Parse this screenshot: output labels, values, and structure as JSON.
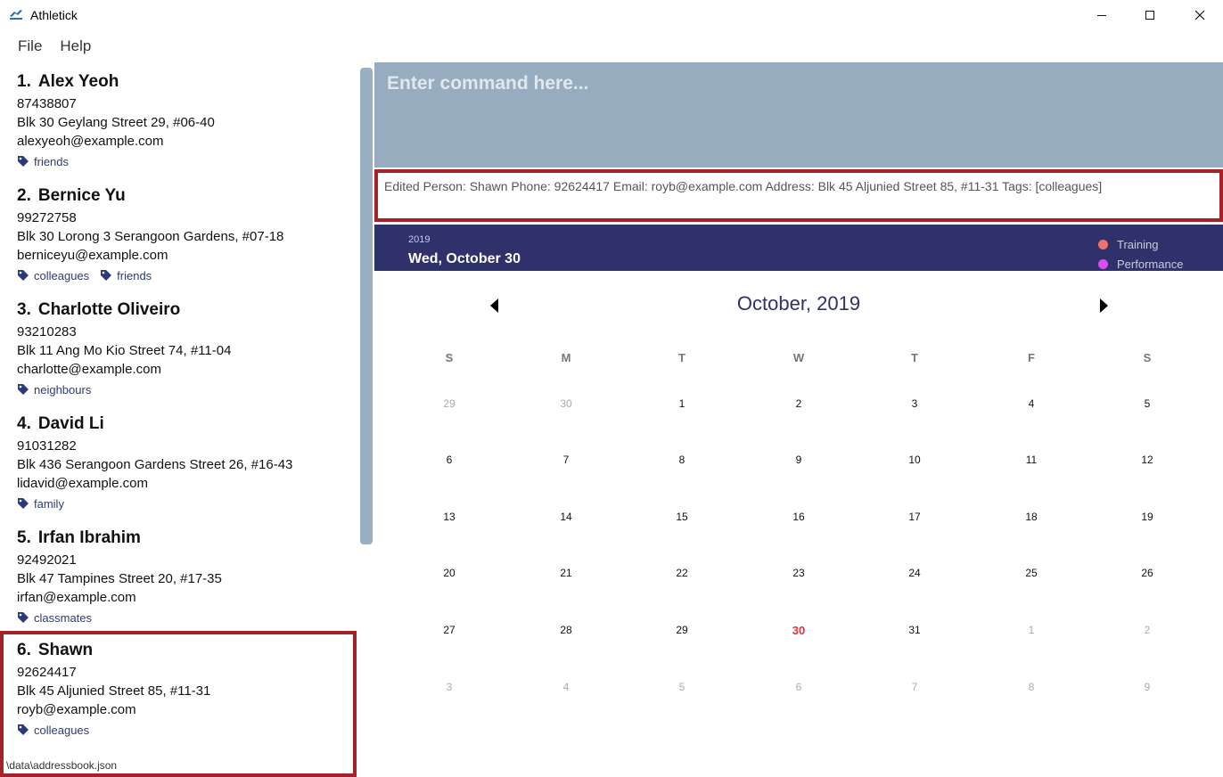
{
  "window": {
    "title": "Athletick",
    "minimize_label": "—",
    "maximize_label": "☐",
    "close_label": "✕"
  },
  "menu": {
    "items": [
      {
        "label": "File"
      },
      {
        "label": "Help"
      }
    ]
  },
  "persons": [
    {
      "index": "1.",
      "name": "Alex Yeoh",
      "phone": "87438807",
      "address": "Blk 30 Geylang Street 29, #06-40",
      "email": "alexyeoh@example.com",
      "tags": [
        "friends"
      ]
    },
    {
      "index": "2.",
      "name": "Bernice Yu",
      "phone": "99272758",
      "address": "Blk 30 Lorong 3 Serangoon Gardens, #07-18",
      "email": "berniceyu@example.com",
      "tags": [
        "colleagues",
        "friends"
      ]
    },
    {
      "index": "3.",
      "name": "Charlotte Oliveiro",
      "phone": "93210283",
      "address": "Blk 11 Ang Mo Kio Street 74, #11-04",
      "email": "charlotte@example.com",
      "tags": [
        "neighbours"
      ]
    },
    {
      "index": "4.",
      "name": "David Li",
      "phone": "91031282",
      "address": "Blk 436 Serangoon Gardens Street 26, #16-43",
      "email": "lidavid@example.com",
      "tags": [
        "family"
      ]
    },
    {
      "index": "5.",
      "name": "Irfan Ibrahim",
      "phone": "92492021",
      "address": "Blk 47 Tampines Street 20, #17-35",
      "email": "irfan@example.com",
      "tags": [
        "classmates"
      ]
    },
    {
      "index": "6.",
      "name": "Shawn",
      "phone": "92624417",
      "address": "Blk 45 Aljunied Street 85, #11-31",
      "email": "royb@example.com",
      "tags": [
        "colleagues"
      ]
    }
  ],
  "status_bar": {
    "storage_path": "\\data\\addressbook.json"
  },
  "command": {
    "placeholder": "Enter command here..."
  },
  "result": {
    "text": "Edited Person: Shawn Phone: 92624417 Email: royb@example.com Address: Blk 45 Aljunied Street 85, #11-31 Tags: [colleagues]"
  },
  "calendar_header": {
    "year": "2019",
    "date": "Wed, October 30",
    "legend": [
      {
        "label": "Training",
        "color": "#f07070"
      },
      {
        "label": "Performance",
        "color": "#d94ef0"
      }
    ]
  },
  "calendar": {
    "month_title": "October, 2019",
    "prev_icon": "caret-left-icon",
    "next_icon": "caret-right-icon",
    "weekdays": [
      "S",
      "M",
      "T",
      "W",
      "T",
      "F",
      "S"
    ],
    "today": "30",
    "today_color": "#e0303a",
    "weeks": [
      [
        {
          "d": "29",
          "m": true
        },
        {
          "d": "30",
          "m": true
        },
        {
          "d": "1"
        },
        {
          "d": "2"
        },
        {
          "d": "3"
        },
        {
          "d": "4"
        },
        {
          "d": "5"
        }
      ],
      [
        {
          "d": "6"
        },
        {
          "d": "7"
        },
        {
          "d": "8"
        },
        {
          "d": "9"
        },
        {
          "d": "10"
        },
        {
          "d": "11"
        },
        {
          "d": "12"
        }
      ],
      [
        {
          "d": "13"
        },
        {
          "d": "14"
        },
        {
          "d": "15"
        },
        {
          "d": "16"
        },
        {
          "d": "17"
        },
        {
          "d": "18"
        },
        {
          "d": "19"
        }
      ],
      [
        {
          "d": "20"
        },
        {
          "d": "21"
        },
        {
          "d": "22"
        },
        {
          "d": "23"
        },
        {
          "d": "24"
        },
        {
          "d": "25"
        },
        {
          "d": "26"
        }
      ],
      [
        {
          "d": "27"
        },
        {
          "d": "28"
        },
        {
          "d": "29"
        },
        {
          "d": "30",
          "today": true
        },
        {
          "d": "31"
        },
        {
          "d": "1",
          "m": true
        },
        {
          "d": "2",
          "m": true
        }
      ],
      [
        {
          "d": "3",
          "m": true
        },
        {
          "d": "4",
          "m": true
        },
        {
          "d": "5",
          "m": true
        },
        {
          "d": "6",
          "m": true
        },
        {
          "d": "7",
          "m": true
        },
        {
          "d": "8",
          "m": true
        },
        {
          "d": "9",
          "m": true
        }
      ]
    ]
  },
  "colors": {
    "accent": "#2f316a",
    "command_bg": "#97adbf",
    "selection_border": "#a52228",
    "tag_color": "#2d3a7a"
  }
}
